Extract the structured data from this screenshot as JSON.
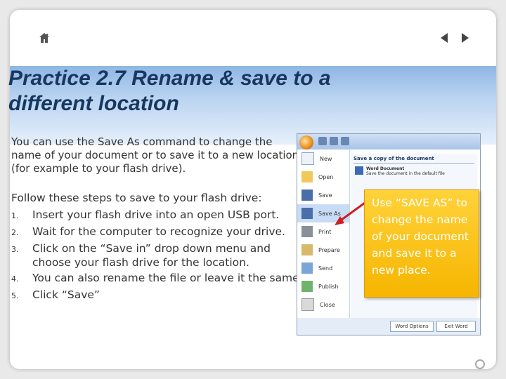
{
  "title": "Practice 2.7 Rename & save to a different location",
  "intro": "You can use the Save As command to change the name of your document or to save it to a new location (for example to your flash drive).",
  "steps_intro": "Follow these steps to save to your flash drive:",
  "steps": [
    {
      "num": "1.",
      "text": "Insert your flash drive into an open USB port."
    },
    {
      "num": "2.",
      "text": "Wait for the computer to recognize your drive."
    },
    {
      "num": "3.",
      "text": "Click on the “Save in” drop down menu and choose your flash drive for the location."
    },
    {
      "num": "4.",
      "text": "You can also rename the file or leave it the same."
    },
    {
      "num": "5.",
      "text": "Click “Save”"
    }
  ],
  "callout": "Use “SAVE AS” to change the name of your document and save it to a new place.",
  "screenshot": {
    "menu_items": [
      "New",
      "Open",
      "Save",
      "Save As",
      "Print",
      "Prepare",
      "Send",
      "Publish",
      "Close"
    ],
    "submenu_title": "Save a copy of the document",
    "submenu_item_title": "Word Document",
    "submenu_item_desc": "Save the document in the default file",
    "word_options": "Word Options",
    "exit_word": "Exit Word"
  },
  "icons": {
    "home": "home-icon",
    "prev": "arrow-left-icon",
    "next": "arrow-right-icon"
  },
  "colors": {
    "title": "#17375e",
    "callout": "#f6b500",
    "arrow": "#cc1f1f"
  }
}
